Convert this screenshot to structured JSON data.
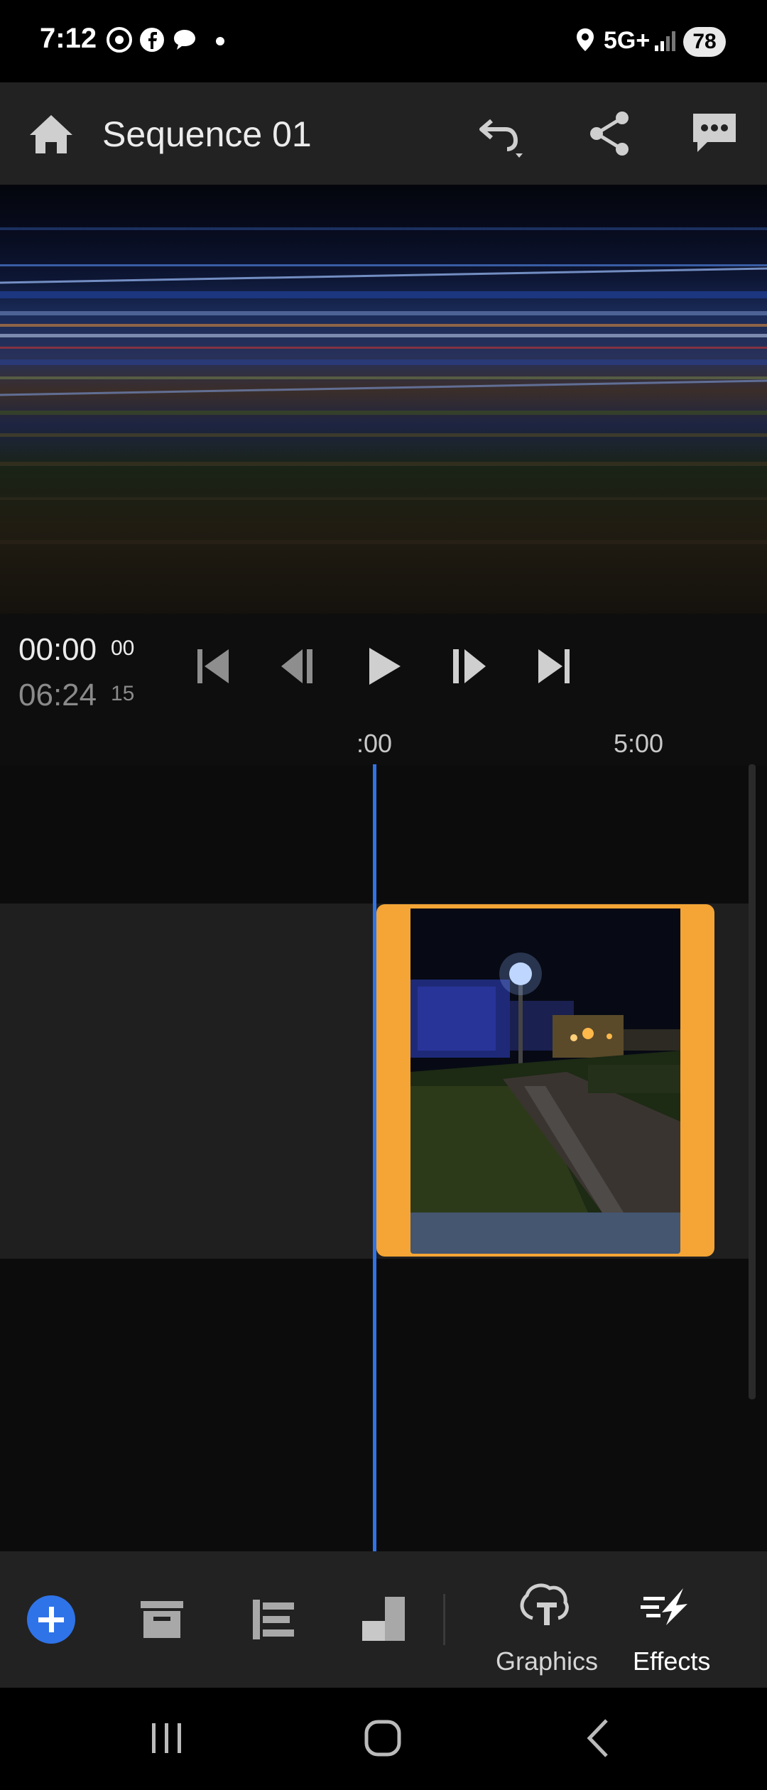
{
  "status_bar": {
    "time": "7:12",
    "network": "5G+",
    "battery": "78",
    "icons": [
      "chrome-icon",
      "facebook-icon",
      "messages-icon",
      "notification-dot-icon",
      "location-icon",
      "signal-icon"
    ]
  },
  "header": {
    "title": "Sequence 01",
    "icons": [
      "home-icon",
      "undo-icon",
      "share-icon",
      "comments-icon"
    ]
  },
  "transport": {
    "current_time": "00:00",
    "current_frames": "00",
    "duration": "06:24",
    "duration_frames": "15",
    "icons": [
      "skip-to-start-icon",
      "step-back-icon",
      "play-icon",
      "step-forward-icon",
      "skip-to-end-icon"
    ]
  },
  "ruler": {
    "labels": [
      ":00",
      "5:00"
    ]
  },
  "toolbar": {
    "graphics_label": "Graphics",
    "effects_label": "Effects",
    "icons": [
      "add-media-icon",
      "media-bin-icon",
      "tracks-icon",
      "aspect-icon",
      "graphics-icon",
      "effects-icon"
    ]
  },
  "colors": {
    "accent": "#2f73e8",
    "clip_selection": "#f4a535",
    "header_bg": "#222222"
  }
}
